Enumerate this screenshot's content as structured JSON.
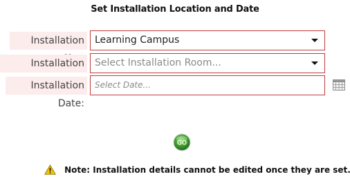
{
  "dialog": {
    "title": "Set Installation Location and Date"
  },
  "form": {
    "site": {
      "label": "Installation Site:",
      "value": "Learning Campus"
    },
    "room": {
      "label": "Installation Room:",
      "placeholder": "Select Installation Room..."
    },
    "date": {
      "label": "Installation Date:",
      "placeholder": "Select Date..."
    }
  },
  "actions": {
    "go_label": "GO",
    "go_color": "#3a9a2a"
  },
  "note": {
    "text": "Note: Installation details cannot be edited once they are set."
  },
  "colors": {
    "field_border": "#c23b3b",
    "label_background": "#fdecec",
    "warning_icon": "#f2c200"
  },
  "icons": {
    "site_dropdown": "chevron-down-icon",
    "room_dropdown": "chevron-down-icon",
    "date_picker": "calendar-icon",
    "note": "warning-icon"
  }
}
